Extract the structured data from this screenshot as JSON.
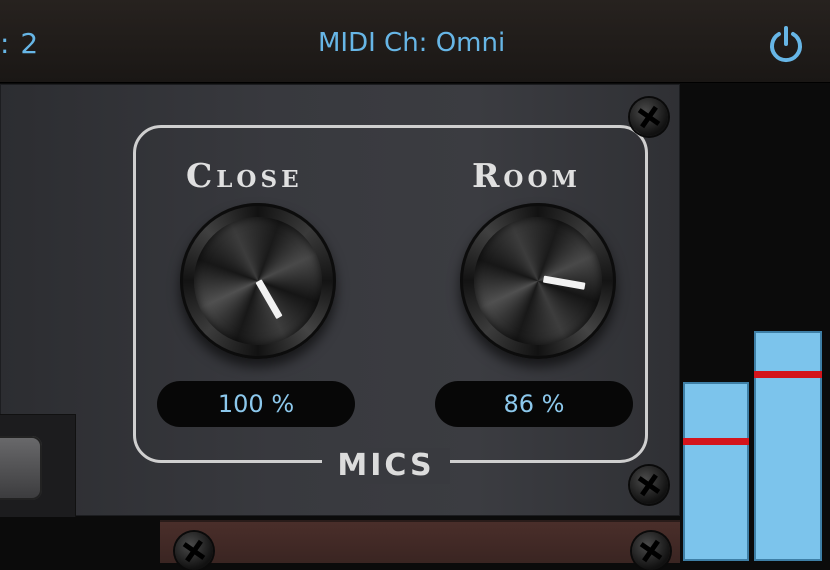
{
  "header": {
    "channel_text": ": 2",
    "midi_label": "MIDI Ch: Omni",
    "power_icon": "power-icon",
    "accent_color": "#67b6e6"
  },
  "mics": {
    "group_label": "Mics",
    "close": {
      "label": "Close",
      "value": 100,
      "readout": "100 %"
    },
    "room": {
      "label": "Room",
      "value": 86,
      "readout": "86 %"
    }
  },
  "meters": {
    "left_level": 0.32,
    "left_peak": 0.22,
    "right_level": 0.41,
    "right_peak": 0.34,
    "peak_color": "#d4141c",
    "fill_color": "#7cc4ec"
  }
}
